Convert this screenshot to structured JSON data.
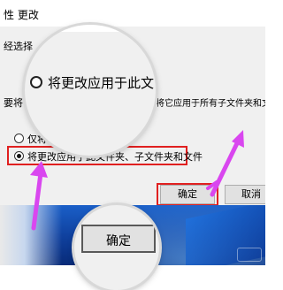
{
  "dialog": {
    "title": "性 更改",
    "line1_partial": "经选择",
    "line2_partial": "要将",
    "line2_rest": "是否要将它应用于所有子文件夹和文件",
    "option1_partial": "仅将",
    "option1_tail": "夹",
    "option2_label": "将更改应用于此文件夹、子文件夹和文件",
    "option2_selected": true,
    "ok_label": "确定",
    "cancel_label": "取消"
  },
  "magnifier_top": {
    "option_label": "将更改应用于此文",
    "selected": true
  },
  "magnifier_bottom": {
    "ok_label": "确定"
  },
  "colors": {
    "highlight": "#e02020",
    "arrow": "#d946ef",
    "dialog_bg": "#f0f0f0"
  },
  "icons": [
    "arrow-up-left",
    "arrow-up-right",
    "radio-selected",
    "radio-unselected"
  ]
}
